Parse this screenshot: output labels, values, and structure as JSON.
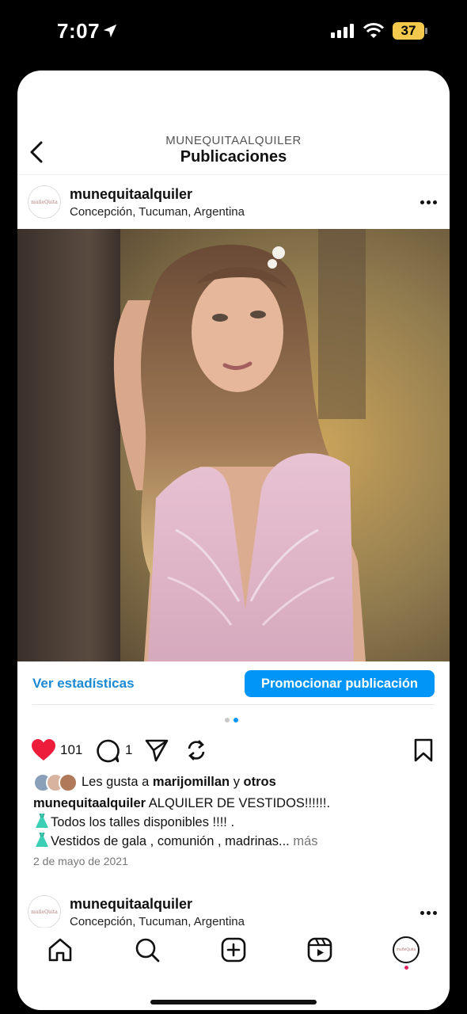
{
  "status_bar": {
    "time": "7:07",
    "battery": "37"
  },
  "header": {
    "account": "MUNEQUITAALQUILER",
    "title": "Publicaciones"
  },
  "post": {
    "username": "munequitaalquiler",
    "location": "Concepción, Tucuman, Argentina",
    "avatar_text": "muñeQuita",
    "stats_link": "Ver estadísticas",
    "promote_button": "Promocionar publicación",
    "carousel": {
      "pages": 2,
      "current": 2
    },
    "like_count": "101",
    "comment_count": "1",
    "likes_prefix": "Les gusta a",
    "likes_user": "marijomillan",
    "likes_and": "y",
    "likes_others": "otros",
    "caption_user": "munequitaalquiler",
    "caption_line1": "ALQUILER DE VESTIDOS!!!!!!.",
    "caption_line2": "Todos los talles disponibles !!!! .",
    "caption_line3": "Vestidos de gala , comunión , madrinas...",
    "more": "más",
    "date": "2 de mayo de 2021"
  },
  "next_post": {
    "username": "munequitaalquiler",
    "location": "Concepción, Tucuman, Argentina"
  },
  "tabbar": {
    "items": [
      "home-icon",
      "search-icon",
      "create-icon",
      "reels-icon",
      "profile-avatar"
    ]
  },
  "colors": {
    "accent": "#0095f6",
    "link": "#1b8ad4",
    "like": "#ed1c3b",
    "battery": "#f2c94c"
  }
}
